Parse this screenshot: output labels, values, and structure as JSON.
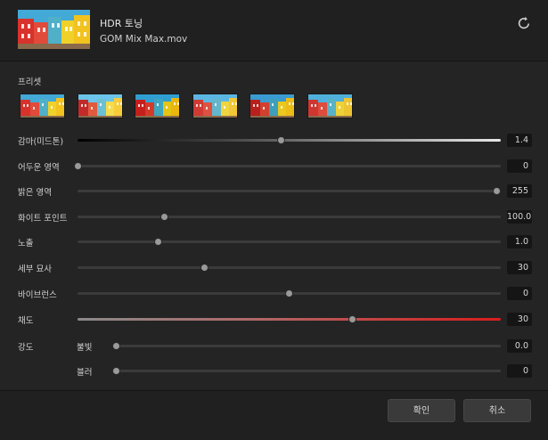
{
  "header": {
    "title": "HDR 토닝",
    "filename": "GOM Mix Max.mov",
    "thumbnail_icon": "video-thumbnail",
    "reset_icon": "reset-icon"
  },
  "presets": {
    "label": "프리셋",
    "count": 6
  },
  "sliders": [
    {
      "label": "감마(미드톤)",
      "value": "1.4",
      "position": 0.48,
      "style": "gamma"
    },
    {
      "label": "어두운 영역",
      "value": "0",
      "position": 0.0,
      "style": "normal"
    },
    {
      "label": "밝은 영역",
      "value": "255",
      "position": 0.99,
      "style": "normal"
    },
    {
      "label": "화이트 포인트",
      "value": "100.0",
      "position": 0.205,
      "style": "normal"
    },
    {
      "label": "노출",
      "value": "1.0",
      "position": 0.19,
      "style": "normal"
    },
    {
      "label": "세부 묘사",
      "value": "30",
      "position": 0.3,
      "style": "normal"
    },
    {
      "label": "바이브런스",
      "value": "0",
      "position": 0.5,
      "style": "normal"
    },
    {
      "label": "채도",
      "value": "30",
      "position": 0.65,
      "style": "saturation"
    }
  ],
  "strength": {
    "label": "강도",
    "items": [
      {
        "label": "불빛",
        "value": "0.0",
        "position": 0.0
      },
      {
        "label": "블러",
        "value": "0",
        "position": 0.0
      }
    ]
  },
  "footer": {
    "confirm_label": "확인",
    "cancel_label": "취소"
  },
  "colors": {
    "background": "#242424",
    "saturation_accent": "#d81d1d",
    "gamma_gradient_end": "#e8e8e8"
  }
}
